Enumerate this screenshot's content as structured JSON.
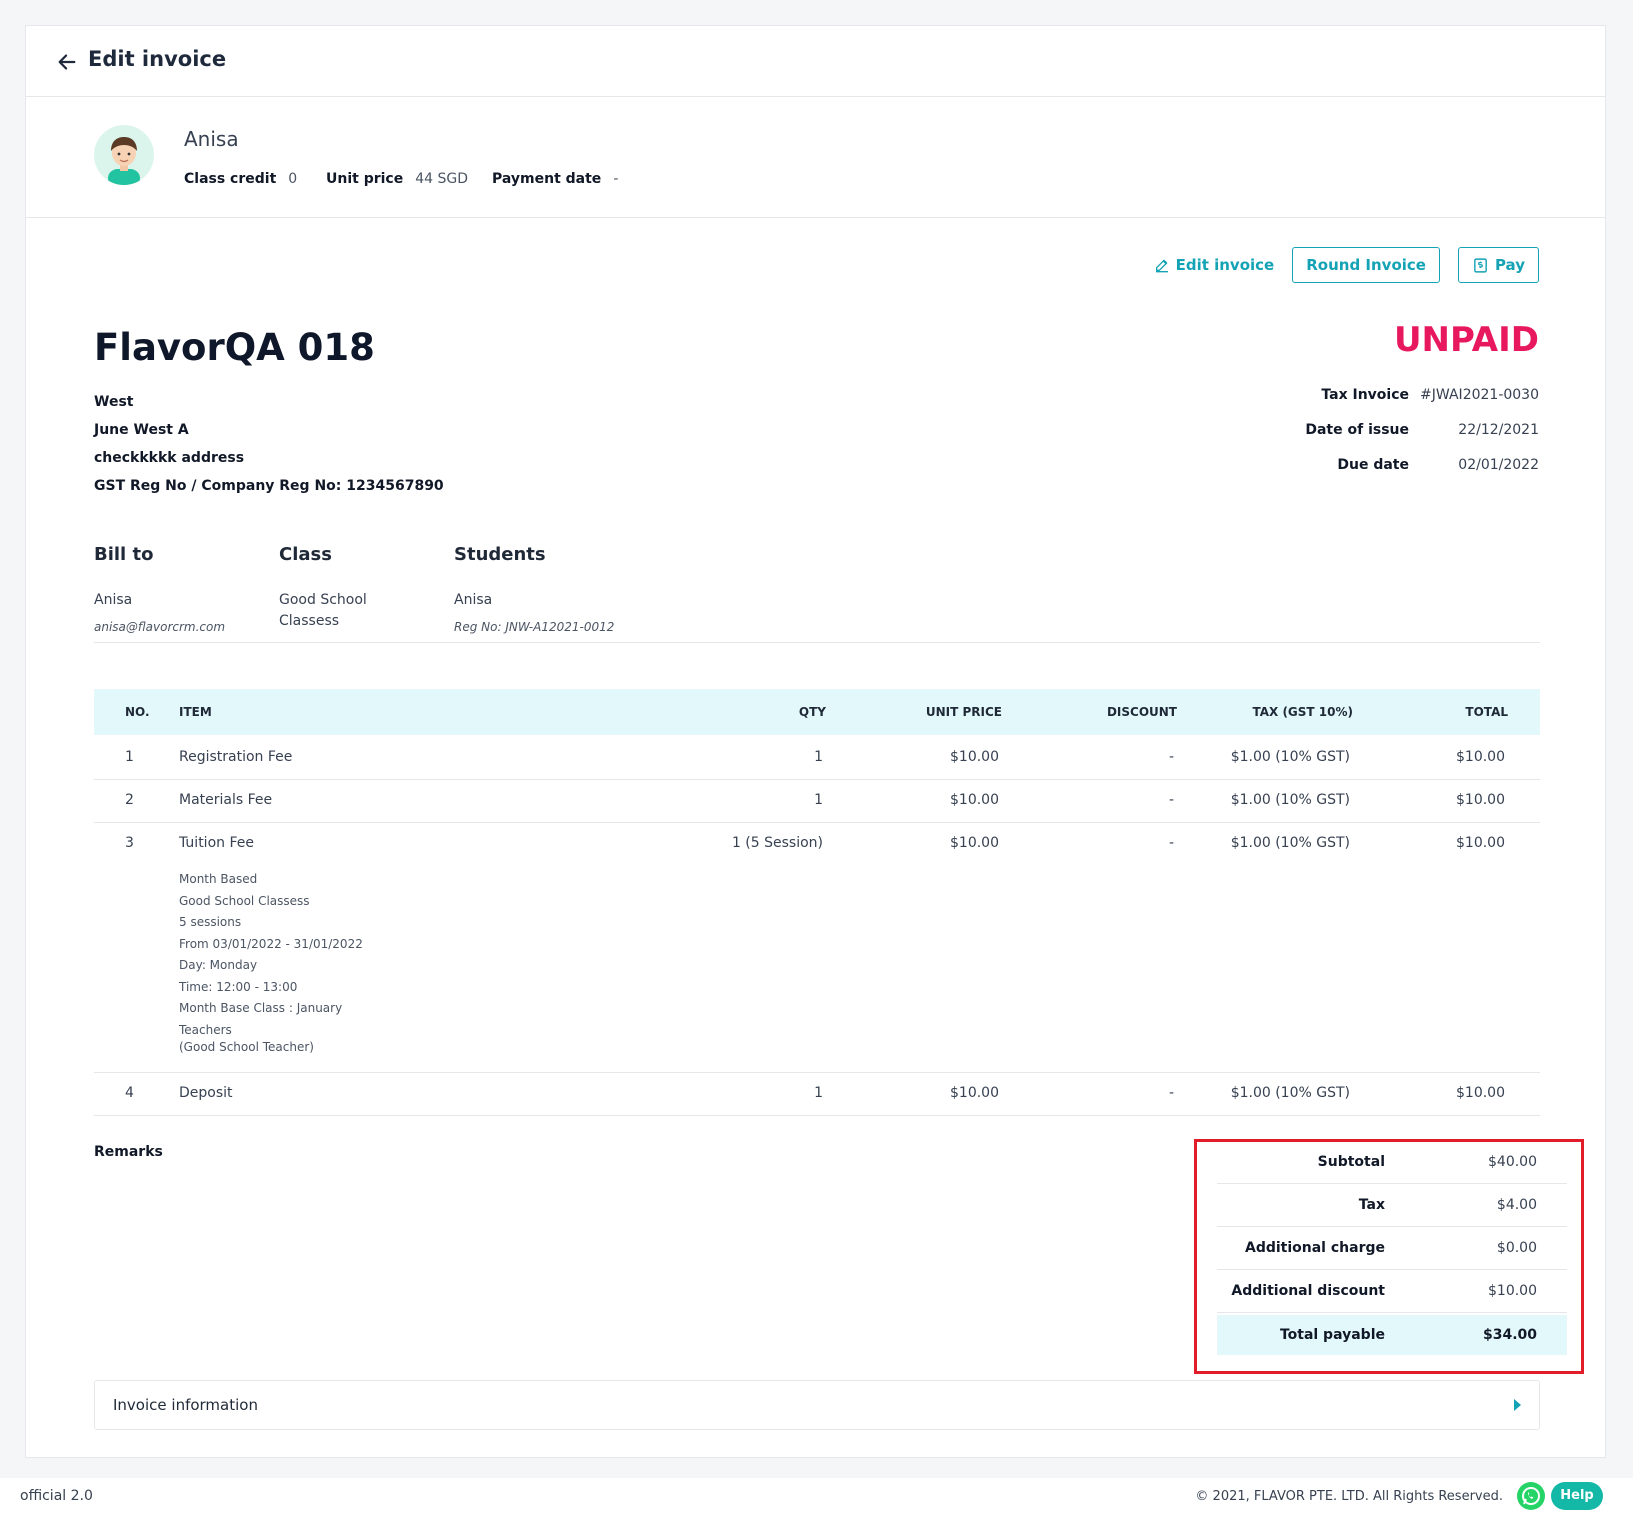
{
  "header": {
    "title": "Edit invoice"
  },
  "profile": {
    "name": "Anisa",
    "class_credit_label": "Class credit",
    "class_credit": "0",
    "unit_price_label": "Unit price",
    "unit_price": "44 SGD",
    "payment_date_label": "Payment date",
    "payment_date": "-"
  },
  "actions": {
    "edit": "Edit invoice",
    "round": "Round Invoice",
    "pay": "Pay"
  },
  "company": {
    "name": "FlavorQA 018",
    "lines": [
      "West",
      "June West A",
      "checkkkkk address",
      "GST Reg No / Company Reg No: 1234567890"
    ]
  },
  "status": {
    "text": "UNPAID",
    "color": "#e8185e"
  },
  "invoice_meta": {
    "tax_invoice_label": "Tax Invoice",
    "tax_invoice": "#JWAI2021-0030",
    "issue_label": "Date of issue",
    "issue": "22/12/2021",
    "due_label": "Due date",
    "due": "02/01/2022"
  },
  "bill_to": {
    "label": "Bill to",
    "name": "Anisa",
    "email": "anisa@flavorcrm.com"
  },
  "class_info": {
    "label": "Class",
    "line1": "Good School",
    "line2": "Classess"
  },
  "students": {
    "label": "Students",
    "name": "Anisa",
    "reg": "Reg No: JNW-A12021-0012"
  },
  "table": {
    "headers": [
      "NO.",
      "ITEM",
      "QTY",
      "UNIT PRICE",
      "DISCOUNT",
      "TAX (GST 10%)",
      "TOTAL"
    ],
    "rows": [
      [
        "1",
        "Registration Fee",
        "1",
        "$10.00",
        "-",
        "$1.00 (10% GST)",
        "$10.00"
      ],
      [
        "2",
        "Materials Fee",
        "1",
        "$10.00",
        "-",
        "$1.00 (10% GST)",
        "$10.00"
      ],
      [
        "3",
        "Tuition Fee",
        "1 (5 Session)",
        "$10.00",
        "-",
        "$1.00 (10% GST)",
        "$10.00"
      ],
      [
        "4",
        "Deposit",
        "1",
        "$10.00",
        "-",
        "$1.00 (10% GST)",
        "$10.00"
      ]
    ],
    "tuition_details": [
      "Month Based",
      "Good School Classess",
      "5 sessions",
      "From 03/01/2022 - 31/01/2022",
      "Day: Monday",
      "Time: 12:00 - 13:00",
      "Month Base Class : January",
      "Teachers",
      "(Good School Teacher)"
    ]
  },
  "remarks_label": "Remarks",
  "totals": [
    {
      "label": "Subtotal",
      "value": "$40.00"
    },
    {
      "label": "Tax",
      "value": "$4.00"
    },
    {
      "label": "Additional charge",
      "value": "$0.00"
    },
    {
      "label": "Additional discount",
      "value": "$10.00"
    },
    {
      "label": "Total payable",
      "value": "$34.00"
    }
  ],
  "invoice_information": "Invoice information",
  "footer": {
    "version": "official 2.0",
    "copyright": "© 2021, FLAVOR PTE. LTD. All Rights Reserved.",
    "help": "Help"
  }
}
